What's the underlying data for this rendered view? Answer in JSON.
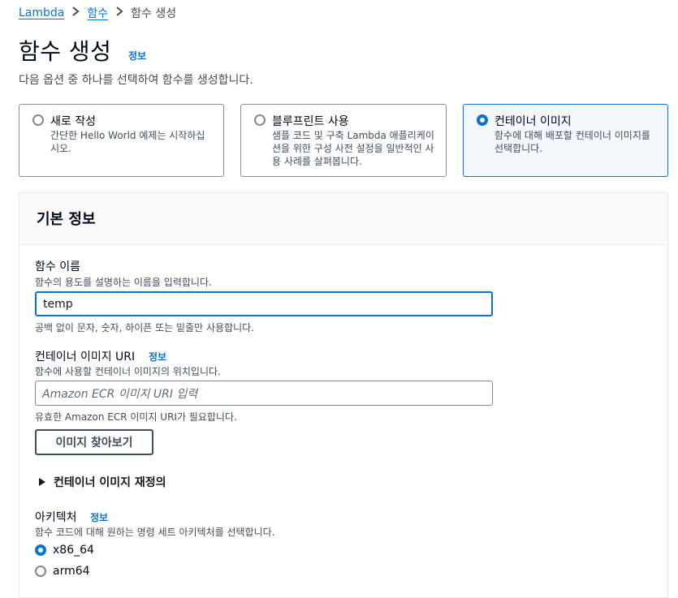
{
  "breadcrumb": {
    "root": "Lambda",
    "parent": "함수",
    "current": "함수 생성"
  },
  "page": {
    "title": "함수 생성",
    "info": "정보",
    "subtitle": "다음 옵션 중 하나를 선택하여 함수를 생성합니다."
  },
  "options": [
    {
      "title": "새로 작성",
      "desc": "간단한 Hello World 예제는 시작하십시오.",
      "selected": false
    },
    {
      "title": "블루프린트 사용",
      "desc": "샘플 코드 및 구축 Lambda 애플리케이션을 위한 구성 사전 설정을 일반적인 사용 사례를 살펴봅니다.",
      "selected": false
    },
    {
      "title": "컨테이너 이미지",
      "desc": "함수에 대해 배포할 컨테이너 이미지를 선택합니다.",
      "selected": true
    }
  ],
  "basic_info": {
    "header": "기본 정보",
    "function_name": {
      "label": "함수 이름",
      "desc": "함수의 용도를 설명하는 이름을 입력합니다.",
      "value": "temp",
      "constraint": "공백 없이 문자, 숫자, 하이픈 또는 밑줄만 사용합니다."
    },
    "image_uri": {
      "label": "컨테이너 이미지 URI",
      "info": "정보",
      "desc": "함수에 사용할 컨테이너 이미지의 위치입니다.",
      "placeholder": "Amazon ECR 이미지 URI 입력",
      "constraint": "유효한 Amazon ECR 이미지 URI가 필요합니다.",
      "browse_button": "이미지 찾아보기"
    },
    "override": {
      "label": "컨테이너 이미지 재정의",
      "expanded": false
    },
    "architecture": {
      "label": "아키텍처",
      "info": "정보",
      "desc": "함수 코드에 대해 원하는 명령 세트 아키텍처를 선택합니다.",
      "options": [
        {
          "label": "x86_64",
          "selected": true
        },
        {
          "label": "arm64",
          "selected": false
        }
      ]
    }
  },
  "colors": {
    "accent": "#0972d3",
    "text": "#000716",
    "muted": "#414d5c",
    "selected_bg": "#f2f8fd"
  }
}
